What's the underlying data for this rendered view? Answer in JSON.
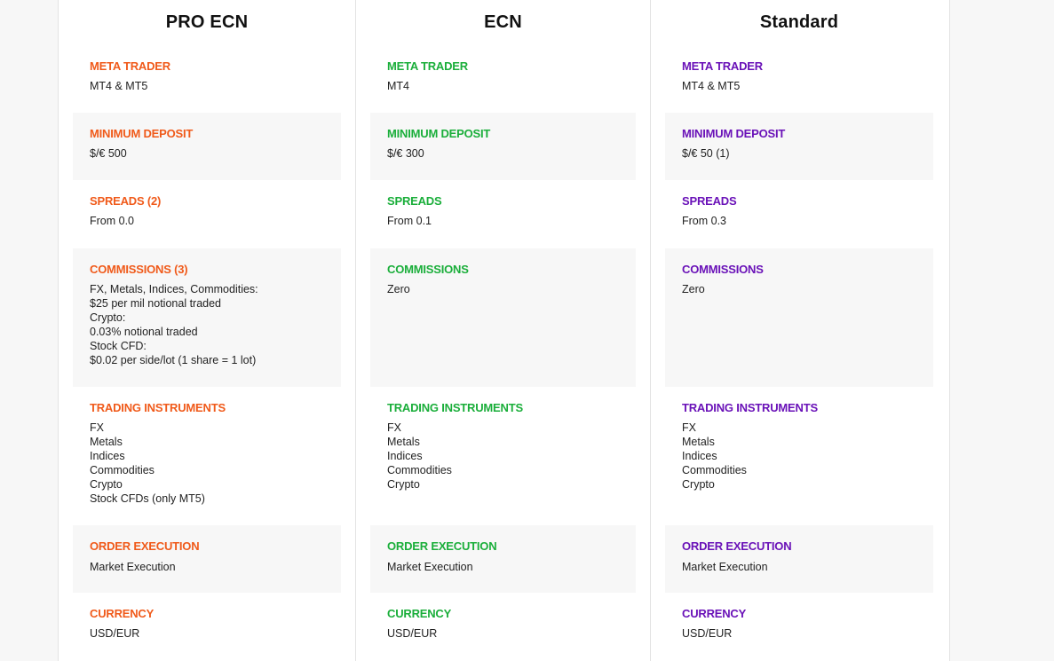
{
  "plans": [
    {
      "title": "PRO ECN",
      "accent": "#f05a1a",
      "meta_trader": {
        "label": "META TRADER",
        "value": "MT4 & MT5"
      },
      "minimum_deposit": {
        "label": "MINIMUM DEPOSIT",
        "value": "$/€ 500"
      },
      "spreads": {
        "label": "SPREADS (2)",
        "value": "From 0.0"
      },
      "commissions": {
        "label": "COMMISSIONS (3)",
        "lines": [
          "FX, Metals, Indices, Commodities:",
          "$25 per mil notional traded",
          "Crypto:",
          "0.03% notional traded",
          "Stock CFD:",
          "$0.02 per side/lot (1 share = 1 lot)"
        ]
      },
      "trading_instruments": {
        "label": "TRADING INSTRUMENTS",
        "lines": [
          "FX",
          "Metals",
          "Indices",
          "Commodities",
          "Crypto",
          "Stock CFDs (only MT5)"
        ]
      },
      "order_execution": {
        "label": "ORDER EXECUTION",
        "value": "Market Execution"
      },
      "currency": {
        "label": "CURRENCY",
        "value": "USD/EUR"
      }
    },
    {
      "title": "ECN",
      "accent": "#1aae3a",
      "meta_trader": {
        "label": "META TRADER",
        "value": "MT4"
      },
      "minimum_deposit": {
        "label": "MINIMUM DEPOSIT",
        "value": "$/€ 300"
      },
      "spreads": {
        "label": "SPREADS",
        "value": "From 0.1"
      },
      "commissions": {
        "label": "COMMISSIONS",
        "lines": [
          "Zero"
        ]
      },
      "trading_instruments": {
        "label": "TRADING INSTRUMENTS",
        "lines": [
          "FX",
          "Metals",
          "Indices",
          "Commodities",
          "Crypto"
        ]
      },
      "order_execution": {
        "label": "ORDER EXECUTION",
        "value": "Market Execution"
      },
      "currency": {
        "label": "CURRENCY",
        "value": "USD/EUR"
      }
    },
    {
      "title": "Standard",
      "accent": "#6a12b8",
      "meta_trader": {
        "label": "META TRADER",
        "value": "MT4 & MT5"
      },
      "minimum_deposit": {
        "label": "MINIMUM DEPOSIT",
        "value": "$/€ 50 (1)"
      },
      "spreads": {
        "label": "SPREADS",
        "value": "From 0.3"
      },
      "commissions": {
        "label": "COMMISSIONS",
        "lines": [
          "Zero"
        ]
      },
      "trading_instruments": {
        "label": "TRADING INSTRUMENTS",
        "lines": [
          "FX",
          "Metals",
          "Indices",
          "Commodities",
          "Crypto"
        ]
      },
      "order_execution": {
        "label": "ORDER EXECUTION",
        "value": "Market Execution"
      },
      "currency": {
        "label": "CURRENCY",
        "value": "USD/EUR"
      }
    }
  ]
}
